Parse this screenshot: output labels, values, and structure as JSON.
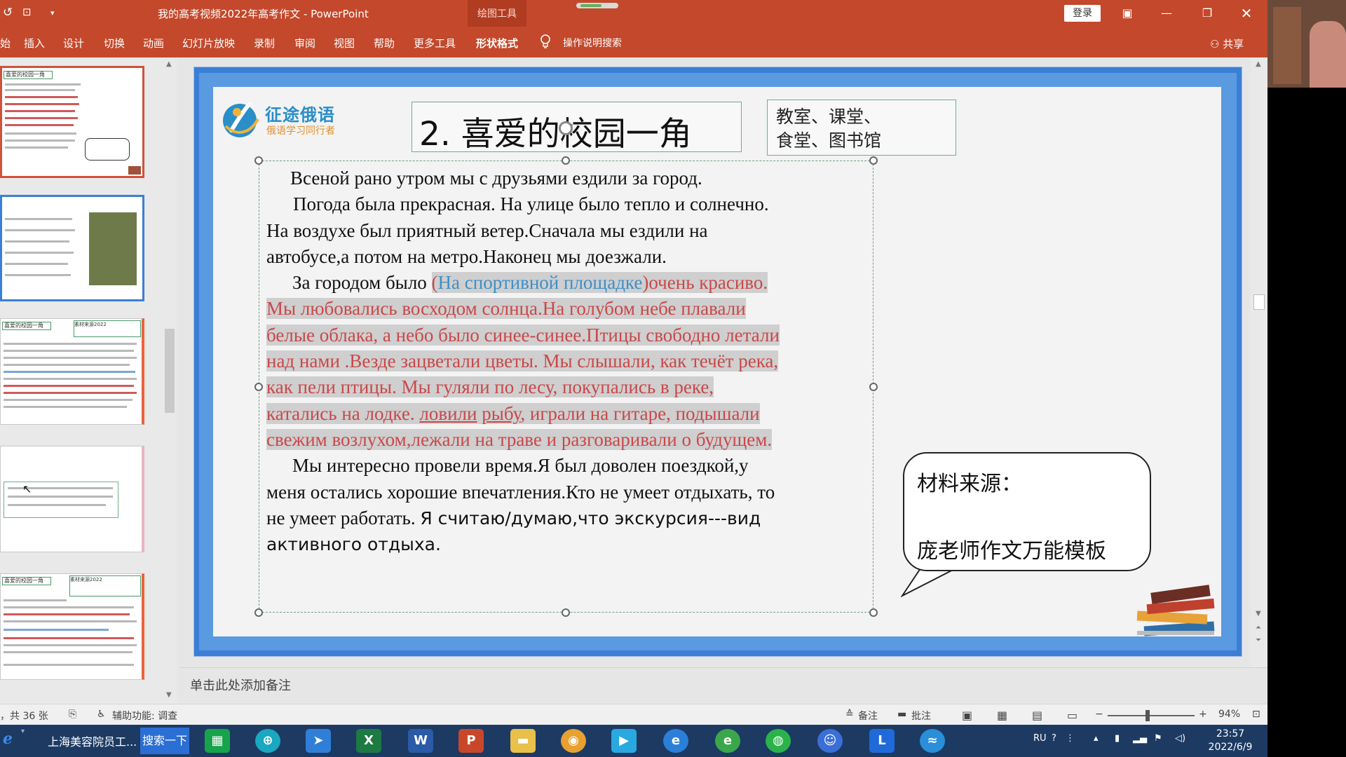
{
  "titlebar": {
    "title": "我的高考视频2022年高考作文 - PowerPoint",
    "context_title": "绘图工具",
    "login_label": "登录"
  },
  "ribbon": {
    "tabs": [
      "插入",
      "设计",
      "切换",
      "动画",
      "幻灯片放映",
      "录制",
      "审阅",
      "视图",
      "帮助",
      "更多工具"
    ],
    "active_tab": "形状格式",
    "tell_me": "操作说明搜索",
    "share": "共享"
  },
  "slide": {
    "logo_name": "征途俄语",
    "logo_sub": "俄语学习同行者",
    "title": "2. 喜爱的校园一角",
    "tags": [
      "教室、课堂、",
      "食堂、图书馆"
    ],
    "body": {
      "p1": "Всеной рано утром мы с друзьями ездили за город.",
      "p2a": "Погода была прекрасная. На улице было тепло и солнечно.",
      "p2b": "На воздухе был приятный ветер.Сначала мы ездили на",
      "p2c": "автобусе,а потом на метро.Наконец мы доезжали.",
      "p3_prefix": "За городом было ",
      "p3_open": "(",
      "p3_blue": "На спортивной площадке",
      "p3_close": ")",
      "p3_red": "очень красиво.",
      "r1": "Мы любовались восходом солнца.На голубом небе плавали",
      "r2": "белые облака, а небо было синее-синее.Птицы свободно летали",
      "r3": "над нами .Везде зацветали цветы. Мы слышали, как течёт река,",
      "r4": "как пели птицы. Мы гуляли по лесу, покупались в реке,",
      "r5a": "катались на лодке. ",
      "r5u1": "ловили",
      "r5sp": " ",
      "r5u2": "рыбу",
      "r5b": ", играли на гитаре, подышали",
      "r6": "свежим возлухом,лежали на траве и разговаривали о будущем.",
      "p5a": "Мы интересно провели время.Я был доволен поездкой,у",
      "p5b": "меня остались хорошие впечатления.Кто не умеет отдыхать, то",
      "p5c_serif": "не умеет работать. ",
      "p5c_sans": "Я считаю/думаю,что экскурсия---вид",
      "p5d": "активного отдыха."
    },
    "bubble": {
      "line1": "材料来源：",
      "line2": "庞老师作文万能模板"
    },
    "accent_color": "#3a7fd5",
    "highlight_red": "#c9484a",
    "highlight_blue": "#3e8fc8"
  },
  "notes": {
    "placeholder": "单击此处添加备注"
  },
  "status": {
    "slide_count": "，共 36 张",
    "accessibility": "辅助功能: 调查",
    "notes_btn": "备注",
    "comments_btn": "批注",
    "zoom": "94%"
  },
  "taskbar": {
    "ie_label": "上海美容院员工...",
    "search_label": "搜索一下",
    "lang": "RU",
    "time": "23:57",
    "date": "2022/6/9"
  }
}
